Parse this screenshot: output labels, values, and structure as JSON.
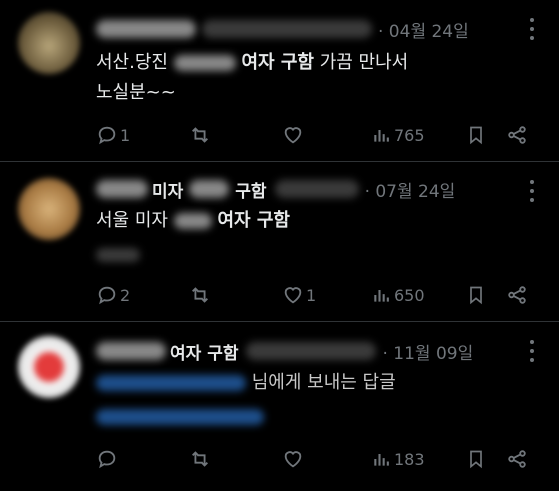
{
  "posts": [
    {
      "avatar_color": "#8a7a55",
      "date": "· 04월 24일",
      "text_line1_pre": "서산.당진",
      "text_line1_bold": "여자  구함",
      "text_line1_post": "가끔 만나서",
      "text_line2": "노실분~~",
      "reply_count": "1",
      "retweet_count": "",
      "like_count": "",
      "view_count": "765"
    },
    {
      "avatar_color": "#c49a5e",
      "name_partial": "미자",
      "name_bold": "구함",
      "date": "· 07월 24일",
      "text_pre": "서울 미자",
      "text_bold": "여자 구함",
      "reply_count": "2",
      "retweet_count": "",
      "like_count": "1",
      "view_count": "650"
    },
    {
      "avatar_color": "#e33b3b",
      "name_bold": "여자 구함",
      "date": "· 11월 09일",
      "reply_suffix": "님에게 보내는 답글",
      "reply_count": "",
      "retweet_count": "",
      "like_count": "",
      "view_count": "183"
    }
  ]
}
